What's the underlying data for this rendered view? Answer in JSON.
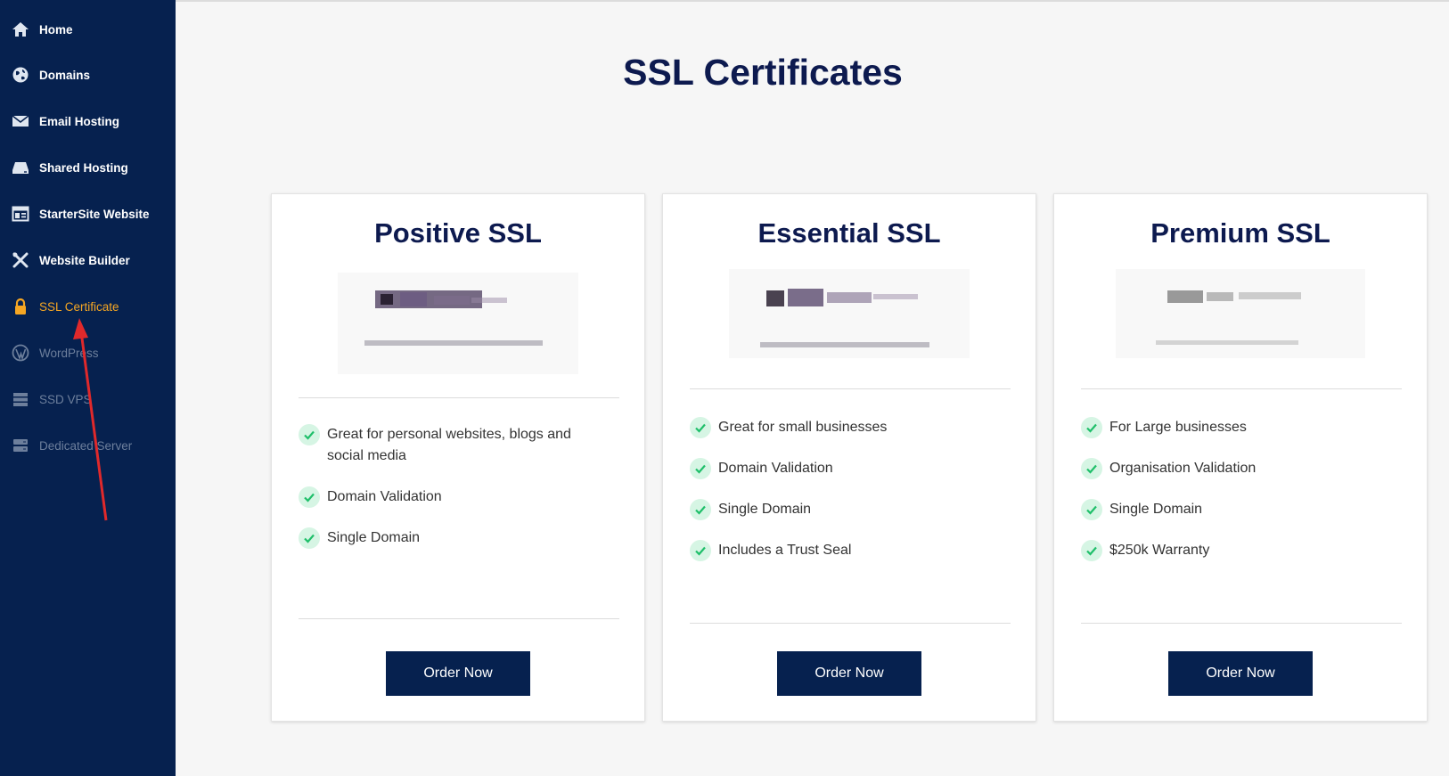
{
  "sidebar": {
    "items": [
      {
        "label": "Home",
        "icon": "home-icon"
      },
      {
        "label": "Domains",
        "icon": "globe-icon"
      },
      {
        "label": "Email Hosting",
        "icon": "envelope-icon"
      },
      {
        "label": "Shared Hosting",
        "icon": "server-icon"
      },
      {
        "label": "StarterSite Website",
        "icon": "layout-icon"
      },
      {
        "label": "Website Builder",
        "icon": "tools-icon"
      },
      {
        "label": "SSL Certificate",
        "icon": "lock-icon",
        "state": "active"
      },
      {
        "label": "WordPress",
        "icon": "wordpress-icon",
        "state": "disabled"
      },
      {
        "label": "SSD VPS",
        "icon": "stack-icon",
        "state": "disabled"
      },
      {
        "label": "Dedicated Server",
        "icon": "rack-server-icon",
        "state": "disabled"
      }
    ],
    "colors": {
      "background": "#06214f",
      "active": "#f5a623",
      "disabled": "#6d7f9c"
    }
  },
  "page": {
    "title": "SSL Certificates"
  },
  "plans": [
    {
      "name": "Positive SSL",
      "features": [
        "Great for personal websites, blogs and social media",
        "Domain Validation",
        "Single Domain"
      ],
      "button": "Order Now"
    },
    {
      "name": "Essential SSL",
      "features": [
        "Great for small businesses",
        "Domain Validation",
        "Single Domain",
        "Includes a Trust Seal"
      ],
      "button": "Order Now"
    },
    {
      "name": "Premium SSL",
      "features": [
        "For Large businesses",
        "Organisation Validation",
        "Single Domain",
        "$250k Warranty"
      ],
      "button": "Order Now"
    }
  ],
  "colors": {
    "brand": "#06214f",
    "heading": "#0d1a4f",
    "check": "#1fbf6a",
    "check_bg": "#d6f5e4",
    "annotation_arrow": "#e0292b"
  }
}
